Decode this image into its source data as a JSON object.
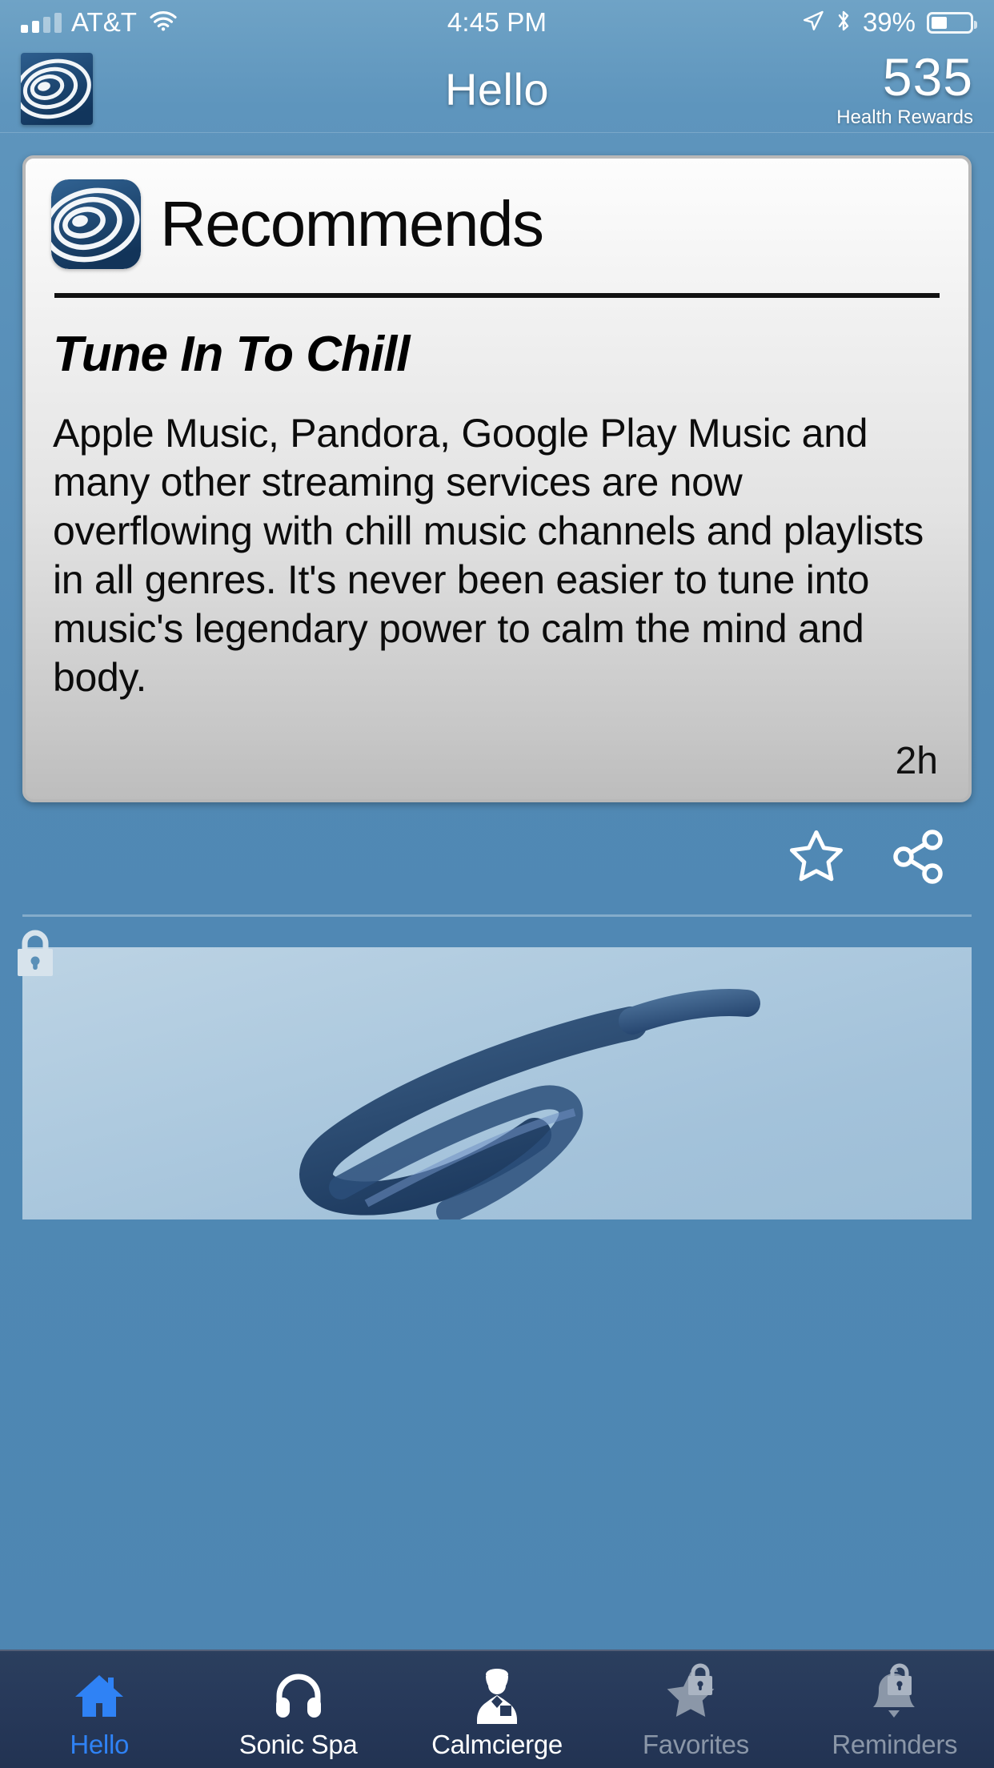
{
  "status_bar": {
    "carrier": "AT&T",
    "time": "4:45 PM",
    "battery_percent": "39%",
    "icons": [
      "signal-bars-icon",
      "wifi-icon",
      "location-arrow-icon",
      "bluetooth-icon",
      "battery-icon"
    ]
  },
  "nav": {
    "title": "Hello",
    "logo_icon": "app-logo-icon",
    "rewards_value": "535",
    "rewards_label": "Health Rewards"
  },
  "card": {
    "brand_icon": "app-logo-icon",
    "brand_title": "Recommends",
    "headline": "Tune In To Chill",
    "body": "Apple Music, Pandora, Google Play Music and many other streaming services are now overflowing with chill music channels and playlists in all genres. It's never been easier to tune into music's legendary power to calm the mind and body.",
    "timestamp": "2h"
  },
  "actions": {
    "favorite_icon": "star-outline-icon",
    "share_icon": "share-nodes-icon"
  },
  "locked_card": {
    "lock_icon": "lock-icon"
  },
  "tabbar": {
    "items": [
      {
        "label": "Hello",
        "icon": "home-icon",
        "active": true,
        "locked": false
      },
      {
        "label": "Sonic Spa",
        "icon": "headphones-icon",
        "active": false,
        "locked": false
      },
      {
        "label": "Calmcierge",
        "icon": "concierge-icon",
        "active": false,
        "locked": false
      },
      {
        "label": "Favorites",
        "icon": "star-icon",
        "active": false,
        "locked": true
      },
      {
        "label": "Reminders",
        "icon": "bell-icon",
        "active": false,
        "locked": true
      }
    ]
  },
  "colors": {
    "app_background": "#5189b4",
    "tabbar_background": "#27395a",
    "accent_active": "#2f82f5",
    "locked_text": "#8b97a8",
    "brand_blue": "#1f4f7d"
  }
}
